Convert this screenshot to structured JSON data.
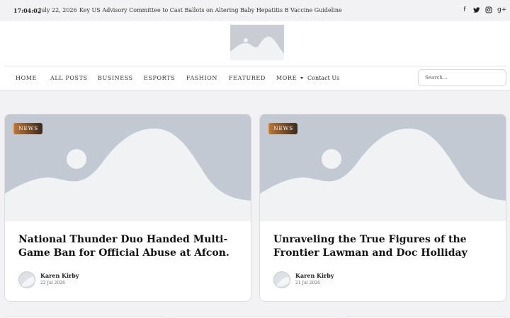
{
  "topbar": {
    "time": "17:04:02",
    "date": "July 22, 2026",
    "ticker": "Key US Advisory Committee to Cast Ballots on Altering Baby Hepatitis B Vaccine Guideline"
  },
  "social": {
    "facebook": "f",
    "twitter": "t",
    "instagram": "◎",
    "googleplus": "g+"
  },
  "nav": {
    "items": [
      "HOME",
      "ALL POSTS",
      "BUSINESS",
      "ESPORTS",
      "FASHION",
      "FEATURED",
      "MORE",
      "Contact Us"
    ]
  },
  "search": {
    "placeholder": "Search..."
  },
  "posts": [
    {
      "badge": "NEWS",
      "title": "National Thunder Duo Handed Multi-Game Ban for Official Abuse at Afcon.",
      "author": "Karen Kirby",
      "date": "22 Jul 2026"
    },
    {
      "badge": "NEWS",
      "title": "Unraveling the True Figures of the Frontier Lawman and Doc Holliday",
      "author": "Karen Kirby",
      "date": "21 Jul 2026"
    }
  ],
  "colors": {
    "accent": "#b5773b",
    "placeholder_bg": "#c3c9d2"
  }
}
